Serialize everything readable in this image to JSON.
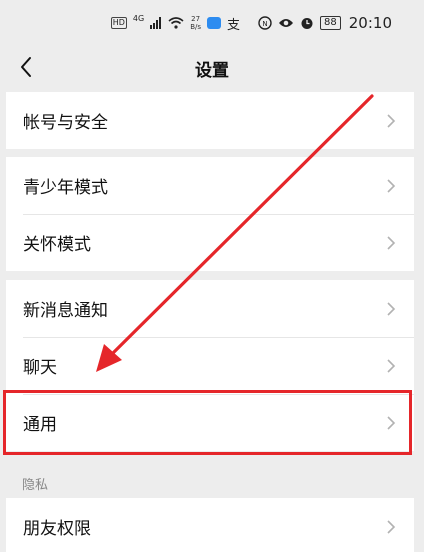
{
  "status_bar": {
    "hd": "HD",
    "signal": "4G",
    "net_speed_value": "27",
    "net_speed_unit": "B/s",
    "battery": "88",
    "time": "20:10"
  },
  "nav": {
    "title": "设置"
  },
  "groups": [
    {
      "items": [
        "帐号与安全"
      ]
    },
    {
      "items": [
        "青少年模式",
        "关怀模式"
      ]
    },
    {
      "items": [
        "新消息通知",
        "聊天",
        "通用"
      ]
    }
  ],
  "privacy_section": {
    "label": "隐私",
    "items": [
      "朋友权限"
    ]
  },
  "annotation": {
    "color": "#e5262a",
    "highlighted_item": "通用"
  }
}
